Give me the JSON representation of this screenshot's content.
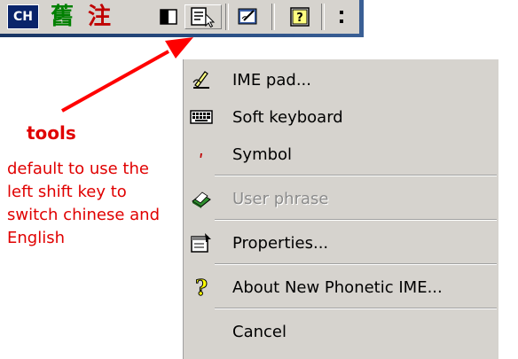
{
  "toolbar": {
    "lang_label": "CH",
    "ime_glyph_1": "舊",
    "ime_glyph_2": "注"
  },
  "menu": {
    "items": [
      {
        "label": "IME pad...",
        "icon": "ime-pad-icon",
        "enabled": true
      },
      {
        "label": "Soft keyboard",
        "icon": "soft-keyboard-icon",
        "enabled": true
      },
      {
        "label": "Symbol",
        "icon": "symbol-icon",
        "enabled": true
      },
      {
        "label": "User phrase",
        "icon": "user-phrase-icon",
        "enabled": false
      },
      {
        "label": "Properties...",
        "icon": "properties-icon",
        "enabled": true
      },
      {
        "label": "About New Phonetic IME...",
        "icon": "help-icon",
        "enabled": true
      },
      {
        "label": "Cancel",
        "icon": "",
        "enabled": true
      }
    ]
  },
  "annotation": {
    "title": "tools",
    "note": "default to use the left shift key to switch chinese and English",
    "color": "#e00000"
  },
  "colors": {
    "toolbar_bg": "#d6d3ce",
    "menu_bg": "#d6d3ce",
    "selected_lang_bg": "#0a246a"
  }
}
